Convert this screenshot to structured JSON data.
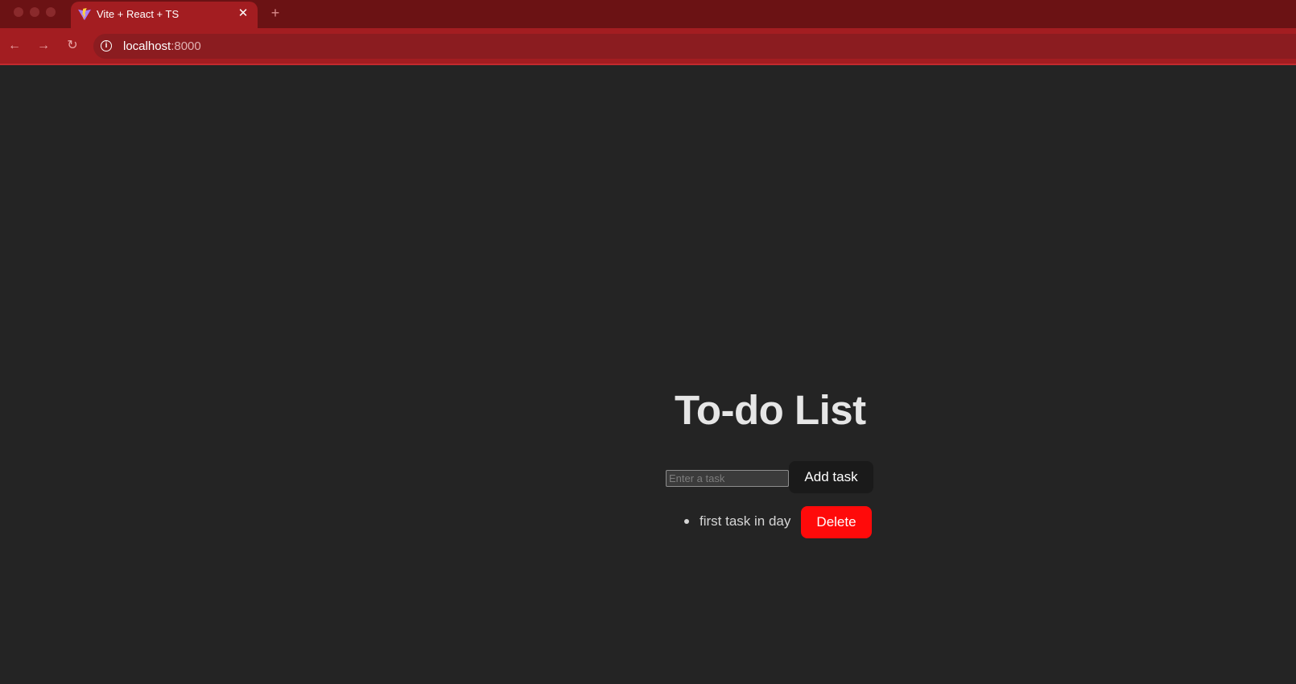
{
  "browser": {
    "tab_title": "Vite + React + TS",
    "url_host": "localhost",
    "url_port": ":8000",
    "icons": {
      "close": "close-icon",
      "new_tab": "plus-icon",
      "back": "back-arrow-icon",
      "forward": "forward-arrow-icon",
      "reload": "reload-icon",
      "info": "info-icon",
      "favicon": "vite-logo-icon"
    },
    "colors": {
      "titlebar": "#6b1214",
      "tab": "#a31d21",
      "toolbar": "#a31d21"
    }
  },
  "app": {
    "heading": "To-do List",
    "input_placeholder": "Enter a task",
    "input_value": "",
    "add_button_label": "Add task",
    "tasks": [
      {
        "text": "first task in day",
        "delete_label": "Delete"
      }
    ],
    "colors": {
      "background": "#242424",
      "delete_button": "#ff0a0a",
      "add_button": "#1a1a1a"
    }
  }
}
